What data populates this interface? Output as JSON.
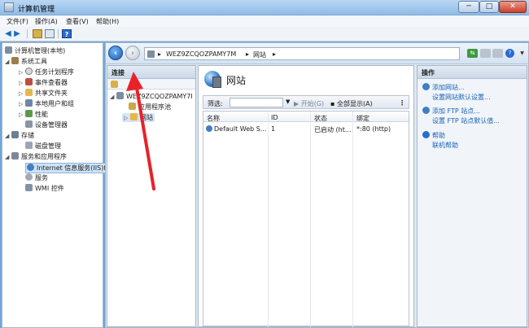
{
  "window": {
    "title": "计算机管理",
    "buttons": {
      "min": "─",
      "max": "□",
      "close": "✕"
    }
  },
  "menu": [
    "文件(F)",
    "操作(A)",
    "查看(V)",
    "帮助(H)"
  ],
  "tree": {
    "root": "计算机管理(本地)",
    "items": [
      {
        "label": "系统工具",
        "icon": "tools-icon"
      },
      {
        "label": "任务计划程序",
        "icon": "clock-icon"
      },
      {
        "label": "事件查看器",
        "icon": "event-viewer-icon"
      },
      {
        "label": "共享文件夹",
        "icon": "folder-icon"
      },
      {
        "label": "本地用户和组",
        "icon": "users-icon"
      },
      {
        "label": "性能",
        "icon": "performance-icon"
      },
      {
        "label": "设备管理器",
        "icon": "device-icon"
      },
      {
        "label": "存储",
        "icon": "storage-icon"
      },
      {
        "label": "磁盘管理",
        "icon": "disk-icon"
      },
      {
        "label": "服务和应用程序",
        "icon": "services-apps-icon"
      },
      {
        "label": "Internet 信息服务(IIS)f",
        "icon": "iis-icon"
      },
      {
        "label": "服务",
        "icon": "gear-icon"
      },
      {
        "label": "WMI 控件",
        "icon": "wmi-icon"
      }
    ]
  },
  "iis": {
    "breadcrumb": [
      "WEZ9ZCQOZPAMY7M",
      "网站"
    ],
    "connections": {
      "header": "连接",
      "server": "WEZ9ZCQOZPAMY7I",
      "app_pools": "应用程序池",
      "sites": "网站"
    },
    "page_title": "网站",
    "filter": {
      "label": "筛选:",
      "start": "开始(G)",
      "show_all": "全部显示(A)"
    },
    "table": {
      "columns": [
        "名称",
        "ID",
        "状态",
        "绑定"
      ],
      "rows": [
        {
          "name": "Default Web S...",
          "id": "1",
          "status": "已启动 (ht...",
          "binding": "*:80 (http)"
        }
      ]
    },
    "actions": {
      "header": "操作",
      "items": [
        "添加网站...",
        "设置网站默认设置...",
        "添加 FTP 站点...",
        "设置 FTP 站点默认值...",
        "帮助",
        "联机帮助"
      ]
    }
  },
  "colors": {
    "annotation_arrow": "#e8222a",
    "link": "#1760b5"
  }
}
